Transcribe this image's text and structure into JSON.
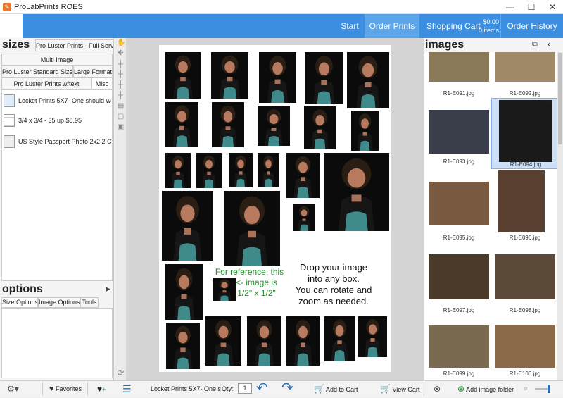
{
  "window": {
    "title": "ProLabPrints ROES",
    "minimize": "—",
    "maximize": "☐",
    "close": "✕"
  },
  "nav": {
    "start": "Start",
    "order_prints": "Order Prints",
    "shopping_cart": "Shopping Cart",
    "cart_total": "$0.00",
    "cart_items": "0 items",
    "order_history": "Order History"
  },
  "sizes": {
    "heading": "sizes",
    "catalog": "Pro Luster Prints - Full Service",
    "tabs": [
      "Multi Image",
      "Pro Luster Standard Sizes",
      "Large Format",
      "Pro Luster Prints w/text",
      "Misc"
    ],
    "items": [
      "Locket Prints 5X7- One should wo...",
      "3/4 x 3/4 - 35 up $8.95",
      "US Style Passport Photo 2x2 2 Co..."
    ]
  },
  "options": {
    "heading": "options",
    "tabs": [
      "Size Options",
      "Image Options",
      "Tools"
    ]
  },
  "canvas": {
    "reference_text": [
      "For reference, this",
      "<- image is",
      "1/2\" x 1/2\""
    ],
    "drop_text": [
      "Drop your image",
      "into any box.",
      "You can rotate and",
      "zoom as needed."
    ]
  },
  "images": {
    "heading": "images",
    "files": [
      "R1-E091.jpg",
      "R1-E092.jpg",
      "R1-E093.jpg",
      "R1-E094.jpg",
      "R1-E095.jpg",
      "R1-E096.jpg",
      "R1-E097.jpg",
      "R1-E098.jpg",
      "R1-E099.jpg",
      "R1-E100.jpg"
    ],
    "selected": "R1-E094.jpg",
    "add_folder": "Add image folder"
  },
  "bottom": {
    "favorites": "Favorites",
    "product": "Locket Prints 5X7- One s",
    "qty_label": "Qty:",
    "qty_value": "1",
    "add_to_cart": "Add to Cart",
    "view_cart": "View Cart"
  },
  "colors": {
    "accent": "#3c8fe0",
    "reference_green": "#21912b"
  }
}
